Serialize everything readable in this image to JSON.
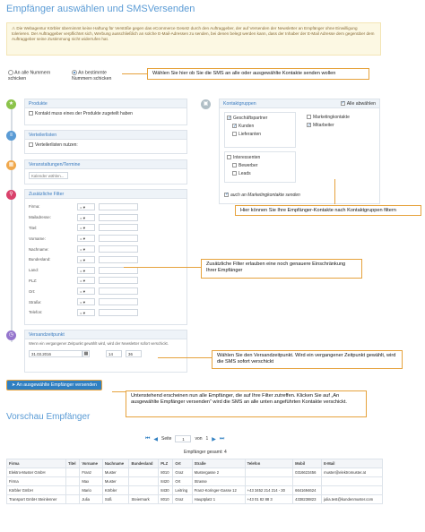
{
  "page_title": "Empfänger auswählen und SMSVersenden",
  "warning_text": "⚠ Die Webagentur Körbler übernimmt keine Haftung für Verstöße gegen das eCommerce Gesetz durch den Auftraggeber, der auf Versenden der Newsletter an Empfänger ohne Einwilligung tolerieren. Der Auftraggeber verpflichtet sich, Werbung ausschließlich an solche E-Mail-Adressen zu senden, bei denen belegt werden kann, dass der Inhaber der E-Mail Adresse dem gegenüber dem Auftraggeber seine Zustimmung nicht widerrufen hat.",
  "send_options": {
    "all": "An alle Nummern schicken",
    "selected": "An bestimmte Nummern schicken"
  },
  "callouts": {
    "choose": "Wählen Sie hier ob Sie die SMS an alle oder ausgewählte Kontakte senden wollen",
    "contacts": "Hier können Sie Ihre Empfänger-Kontakte nach Kontaktgruppen filtern",
    "filters": "Zusätzliche Filter erlauben eine  noch genauere Einschränkung Ihrer Empfänger",
    "time": "Wählen Sie den Versandzeitpunkt. Wird ein vergangener Zeitpunkt gewählt, wird die SMS sofort verschickt",
    "send": "Untenstehend erscheinen nun alle Empfänger, die auf Ihre Filter zutreffen. Klicken Sie auf „An ausgewählte Empfänger versenden“ wird die SMS an alle unten angeführten Kontakte verschickt."
  },
  "produkte": {
    "title": "Produkte",
    "checkbox": "Kontakt muss eines der Produkte zugeteilt haben"
  },
  "verteiler": {
    "title": "Verteilerlisten",
    "label": "Verteilerlisten nutzen:"
  },
  "veranstaltungen": {
    "title": "Veranstaltungen/Termine",
    "select": "Kalender wählen..."
  },
  "filter": {
    "title": "Zusätzliche Filter",
    "fields": [
      "Firma:",
      "Mailadresse:",
      "Titel:",
      "Vorname:",
      "Nachname:",
      "Bundesland:",
      "Land:",
      "PLZ:",
      "Ort:",
      "Straße:",
      "Telefon:"
    ],
    "op": "="
  },
  "versand": {
    "title": "Versandzeitpunkt",
    "note": "Wenn ein vergangener Zeitpunkt gewählt wird, wird der Newsletter sofort verschickt.",
    "date": "31.03.2016",
    "hour": "14",
    "minute": "36"
  },
  "kontaktgruppen": {
    "title": "Kontaktgruppen",
    "all": "Alle abwählen",
    "groups": [
      {
        "label": "Geschäftspartner",
        "on": true
      },
      {
        "label": "Kunden",
        "on": true
      },
      {
        "label": "Lieferanten",
        "on": false
      }
    ],
    "right_groups": [
      {
        "label": "Marketingkontakte",
        "on": false
      },
      {
        "label": "Mitarbeiter",
        "on": true
      }
    ],
    "interest": [
      {
        "label": "Interessenten",
        "on": false
      },
      {
        "label": "Bewerber",
        "on": false
      },
      {
        "label": "Leads",
        "on": false
      }
    ],
    "marketing": "auch an Marketingkontakte senden"
  },
  "send_button": "An ausgewählte Empfänger versenden",
  "preview": {
    "title": "Vorschau Empfänger",
    "pager": {
      "seite": "Seite",
      "page": "1",
      "von": "von",
      "total": "1"
    },
    "count": "Empfänger gesamt: 4",
    "columns": [
      "Firma",
      "Titel",
      "Vorname",
      "Nachname",
      "Bundesland",
      "PLZ",
      "Ort",
      "Straße",
      "Telefon",
      "Mobil",
      "E-Mail"
    ],
    "rows": [
      [
        "Elektro-Muster GmbH",
        "",
        "Franz",
        "Muster",
        "",
        "8010",
        "Graz",
        "Mustergasse 2",
        "",
        "0316623456",
        "muster@elektromuster.at"
      ],
      [
        "Firma",
        "",
        "Max",
        "Muster",
        "",
        "8420",
        "Ort",
        "Strasse",
        "",
        "",
        ""
      ],
      [
        "Körbler GmbH",
        "",
        "Mario",
        "Körbler",
        "",
        "8430",
        "Leitring",
        "Franz-Koringer-Gasse 12",
        "+43 3452 214 214 - 30",
        "6641694624",
        ""
      ],
      [
        "Transport GmbH Steinlenner",
        "",
        "Julia",
        "Süß",
        "Steiermark",
        "8010",
        "Graz",
        "Hauptplatz 1",
        "+43 01 82 88 3",
        "4338238823",
        "julia.test@kundenmuster.com"
      ]
    ]
  },
  "colors": {
    "accent": "#2f7fc1",
    "title": "#5a9bd5",
    "callout_border": "#e6a23c"
  }
}
